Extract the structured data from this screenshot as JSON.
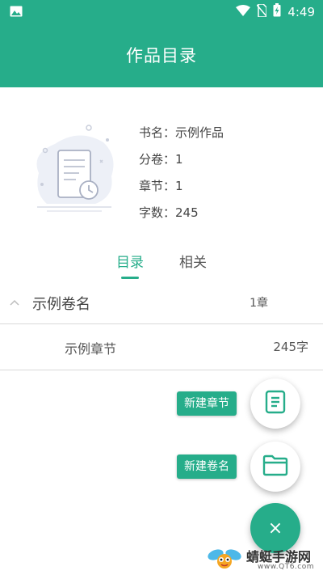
{
  "status_bar": {
    "time": "4:49",
    "icons": [
      "image-icon",
      "wifi-icon",
      "no-sim-icon",
      "battery-charging-icon"
    ]
  },
  "app_bar": {
    "title": "作品目录"
  },
  "book_info": {
    "rows": [
      {
        "label": "书名：",
        "value": "示例作品"
      },
      {
        "label": "分卷：",
        "value": "1"
      },
      {
        "label": "章节：",
        "value": "1"
      },
      {
        "label": "字数：",
        "value": "245"
      }
    ]
  },
  "tabs": [
    {
      "label": "目录",
      "active": true
    },
    {
      "label": "相关",
      "active": false
    }
  ],
  "volume": {
    "name": "示例卷名",
    "chapter_count": "1章"
  },
  "chapters": [
    {
      "name": "示例章节",
      "words": "245字"
    }
  ],
  "fab": {
    "new_chapter_label": "新建章节",
    "new_volume_label": "新建卷名",
    "close_label": "×"
  },
  "watermark": {
    "name": "蜻蜓手游网",
    "url": "www.QT6.com"
  },
  "colors": {
    "accent": "#26ad8a",
    "divider": "#d9d9d9"
  }
}
